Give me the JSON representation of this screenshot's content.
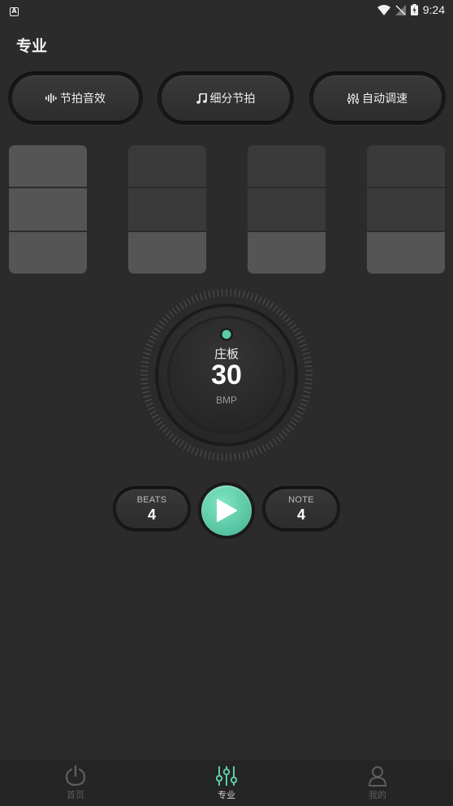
{
  "status_bar": {
    "notification_letter": "A",
    "time": "9:24"
  },
  "page": {
    "title": "专业"
  },
  "options": [
    {
      "label": "节拍音效",
      "icon": "sound-wave-icon"
    },
    {
      "label": "细分节拍",
      "icon": "music-note-icon"
    },
    {
      "label": "自动调速",
      "icon": "sliders-icon"
    }
  ],
  "beats_grid": {
    "columns": 4,
    "rows_per_column": 3
  },
  "dial": {
    "tempo_name": "庄板",
    "bpm": "30",
    "unit": "BMP",
    "accent_color": "#5cc9a7"
  },
  "controls": {
    "beats_label": "BEATS",
    "beats_value": "4",
    "note_label": "NOTE",
    "note_value": "4",
    "play_icon": "play-icon"
  },
  "tabbar": {
    "items": [
      {
        "label": "首页",
        "icon": "power-icon",
        "active": false
      },
      {
        "label": "专业",
        "icon": "equalizer-icon",
        "active": true
      },
      {
        "label": "我的",
        "icon": "user-icon",
        "active": false
      }
    ]
  }
}
